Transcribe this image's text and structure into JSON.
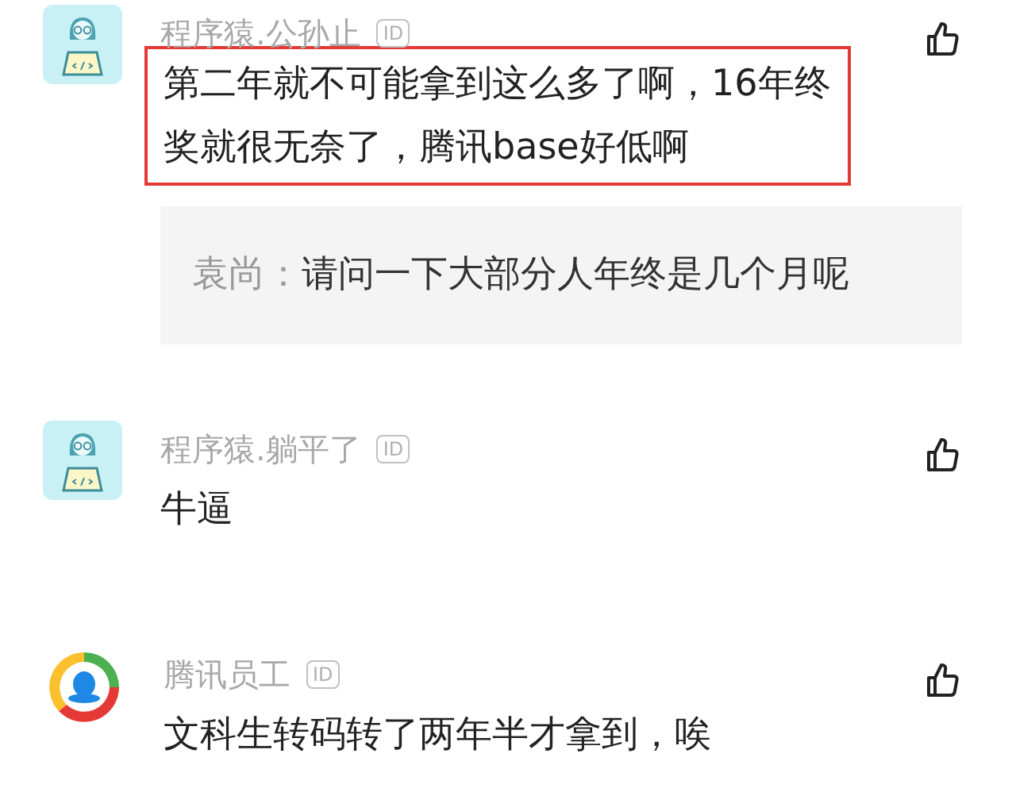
{
  "comments": [
    {
      "avatar": {
        "kind": "coder"
      },
      "author": "程序猿.公孙止",
      "id_badge": "ID",
      "text": "第二年就不可能拿到这么多了啊，16年终奖就很无奈了，腾讯base好低啊",
      "highlighted": true,
      "reply": {
        "author": "袁尚：",
        "text": "请问一下大部分人年终是几个月呢"
      }
    },
    {
      "avatar": {
        "kind": "coder"
      },
      "author": "程序猿.躺平了",
      "id_badge": "ID",
      "text": "牛逼",
      "highlighted": false
    },
    {
      "avatar": {
        "kind": "logo"
      },
      "author": "腾讯员工",
      "id_badge": "ID",
      "text": "文科生转码转了两年半才拿到，唉",
      "highlighted": false
    }
  ]
}
